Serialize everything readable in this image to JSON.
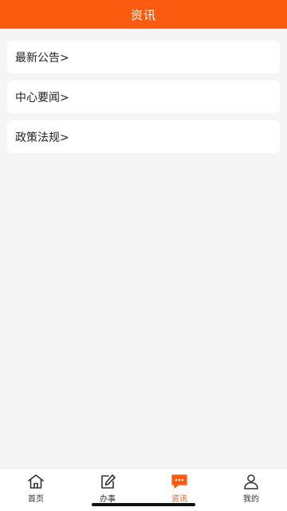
{
  "header": {
    "title": "资讯"
  },
  "list": {
    "items": [
      {
        "label": "最新公告>"
      },
      {
        "label": "中心要闻>"
      },
      {
        "label": "政策法规>"
      }
    ]
  },
  "tabbar": {
    "tabs": [
      {
        "label": "首页",
        "icon": "home-icon",
        "active": false
      },
      {
        "label": "办事",
        "icon": "edit-icon",
        "active": false
      },
      {
        "label": "资讯",
        "icon": "message-icon",
        "active": true
      },
      {
        "label": "我的",
        "icon": "user-icon",
        "active": false
      }
    ]
  },
  "colors": {
    "accent": "#fa5b0f",
    "background": "#f5f5f5",
    "card": "#ffffff",
    "text": "#222222"
  }
}
